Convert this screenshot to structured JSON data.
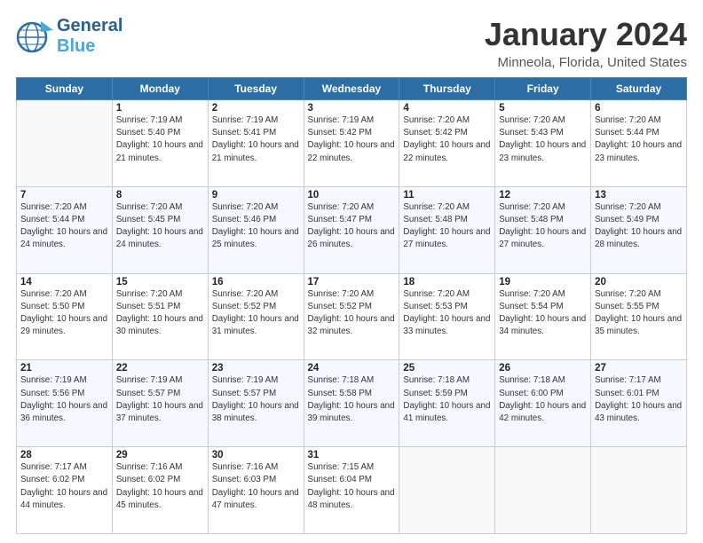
{
  "app": {
    "logo_line1": "General",
    "logo_line2": "Blue",
    "title": "January 2024",
    "subtitle": "Minneola, Florida, United States"
  },
  "calendar": {
    "headers": [
      "Sunday",
      "Monday",
      "Tuesday",
      "Wednesday",
      "Thursday",
      "Friday",
      "Saturday"
    ],
    "weeks": [
      [
        {
          "day": "",
          "sunrise": "",
          "sunset": "",
          "daylight": ""
        },
        {
          "day": "1",
          "sunrise": "Sunrise: 7:19 AM",
          "sunset": "Sunset: 5:40 PM",
          "daylight": "Daylight: 10 hours and 21 minutes."
        },
        {
          "day": "2",
          "sunrise": "Sunrise: 7:19 AM",
          "sunset": "Sunset: 5:41 PM",
          "daylight": "Daylight: 10 hours and 21 minutes."
        },
        {
          "day": "3",
          "sunrise": "Sunrise: 7:19 AM",
          "sunset": "Sunset: 5:42 PM",
          "daylight": "Daylight: 10 hours and 22 minutes."
        },
        {
          "day": "4",
          "sunrise": "Sunrise: 7:20 AM",
          "sunset": "Sunset: 5:42 PM",
          "daylight": "Daylight: 10 hours and 22 minutes."
        },
        {
          "day": "5",
          "sunrise": "Sunrise: 7:20 AM",
          "sunset": "Sunset: 5:43 PM",
          "daylight": "Daylight: 10 hours and 23 minutes."
        },
        {
          "day": "6",
          "sunrise": "Sunrise: 7:20 AM",
          "sunset": "Sunset: 5:44 PM",
          "daylight": "Daylight: 10 hours and 23 minutes."
        }
      ],
      [
        {
          "day": "7",
          "sunrise": "Sunrise: 7:20 AM",
          "sunset": "Sunset: 5:44 PM",
          "daylight": "Daylight: 10 hours and 24 minutes."
        },
        {
          "day": "8",
          "sunrise": "Sunrise: 7:20 AM",
          "sunset": "Sunset: 5:45 PM",
          "daylight": "Daylight: 10 hours and 24 minutes."
        },
        {
          "day": "9",
          "sunrise": "Sunrise: 7:20 AM",
          "sunset": "Sunset: 5:46 PM",
          "daylight": "Daylight: 10 hours and 25 minutes."
        },
        {
          "day": "10",
          "sunrise": "Sunrise: 7:20 AM",
          "sunset": "Sunset: 5:47 PM",
          "daylight": "Daylight: 10 hours and 26 minutes."
        },
        {
          "day": "11",
          "sunrise": "Sunrise: 7:20 AM",
          "sunset": "Sunset: 5:48 PM",
          "daylight": "Daylight: 10 hours and 27 minutes."
        },
        {
          "day": "12",
          "sunrise": "Sunrise: 7:20 AM",
          "sunset": "Sunset: 5:48 PM",
          "daylight": "Daylight: 10 hours and 27 minutes."
        },
        {
          "day": "13",
          "sunrise": "Sunrise: 7:20 AM",
          "sunset": "Sunset: 5:49 PM",
          "daylight": "Daylight: 10 hours and 28 minutes."
        }
      ],
      [
        {
          "day": "14",
          "sunrise": "Sunrise: 7:20 AM",
          "sunset": "Sunset: 5:50 PM",
          "daylight": "Daylight: 10 hours and 29 minutes."
        },
        {
          "day": "15",
          "sunrise": "Sunrise: 7:20 AM",
          "sunset": "Sunset: 5:51 PM",
          "daylight": "Daylight: 10 hours and 30 minutes."
        },
        {
          "day": "16",
          "sunrise": "Sunrise: 7:20 AM",
          "sunset": "Sunset: 5:52 PM",
          "daylight": "Daylight: 10 hours and 31 minutes."
        },
        {
          "day": "17",
          "sunrise": "Sunrise: 7:20 AM",
          "sunset": "Sunset: 5:52 PM",
          "daylight": "Daylight: 10 hours and 32 minutes."
        },
        {
          "day": "18",
          "sunrise": "Sunrise: 7:20 AM",
          "sunset": "Sunset: 5:53 PM",
          "daylight": "Daylight: 10 hours and 33 minutes."
        },
        {
          "day": "19",
          "sunrise": "Sunrise: 7:20 AM",
          "sunset": "Sunset: 5:54 PM",
          "daylight": "Daylight: 10 hours and 34 minutes."
        },
        {
          "day": "20",
          "sunrise": "Sunrise: 7:20 AM",
          "sunset": "Sunset: 5:55 PM",
          "daylight": "Daylight: 10 hours and 35 minutes."
        }
      ],
      [
        {
          "day": "21",
          "sunrise": "Sunrise: 7:19 AM",
          "sunset": "Sunset: 5:56 PM",
          "daylight": "Daylight: 10 hours and 36 minutes."
        },
        {
          "day": "22",
          "sunrise": "Sunrise: 7:19 AM",
          "sunset": "Sunset: 5:57 PM",
          "daylight": "Daylight: 10 hours and 37 minutes."
        },
        {
          "day": "23",
          "sunrise": "Sunrise: 7:19 AM",
          "sunset": "Sunset: 5:57 PM",
          "daylight": "Daylight: 10 hours and 38 minutes."
        },
        {
          "day": "24",
          "sunrise": "Sunrise: 7:18 AM",
          "sunset": "Sunset: 5:58 PM",
          "daylight": "Daylight: 10 hours and 39 minutes."
        },
        {
          "day": "25",
          "sunrise": "Sunrise: 7:18 AM",
          "sunset": "Sunset: 5:59 PM",
          "daylight": "Daylight: 10 hours and 41 minutes."
        },
        {
          "day": "26",
          "sunrise": "Sunrise: 7:18 AM",
          "sunset": "Sunset: 6:00 PM",
          "daylight": "Daylight: 10 hours and 42 minutes."
        },
        {
          "day": "27",
          "sunrise": "Sunrise: 7:17 AM",
          "sunset": "Sunset: 6:01 PM",
          "daylight": "Daylight: 10 hours and 43 minutes."
        }
      ],
      [
        {
          "day": "28",
          "sunrise": "Sunrise: 7:17 AM",
          "sunset": "Sunset: 6:02 PM",
          "daylight": "Daylight: 10 hours and 44 minutes."
        },
        {
          "day": "29",
          "sunrise": "Sunrise: 7:16 AM",
          "sunset": "Sunset: 6:02 PM",
          "daylight": "Daylight: 10 hours and 45 minutes."
        },
        {
          "day": "30",
          "sunrise": "Sunrise: 7:16 AM",
          "sunset": "Sunset: 6:03 PM",
          "daylight": "Daylight: 10 hours and 47 minutes."
        },
        {
          "day": "31",
          "sunrise": "Sunrise: 7:15 AM",
          "sunset": "Sunset: 6:04 PM",
          "daylight": "Daylight: 10 hours and 48 minutes."
        },
        {
          "day": "",
          "sunrise": "",
          "sunset": "",
          "daylight": ""
        },
        {
          "day": "",
          "sunrise": "",
          "sunset": "",
          "daylight": ""
        },
        {
          "day": "",
          "sunrise": "",
          "sunset": "",
          "daylight": ""
        }
      ]
    ]
  }
}
